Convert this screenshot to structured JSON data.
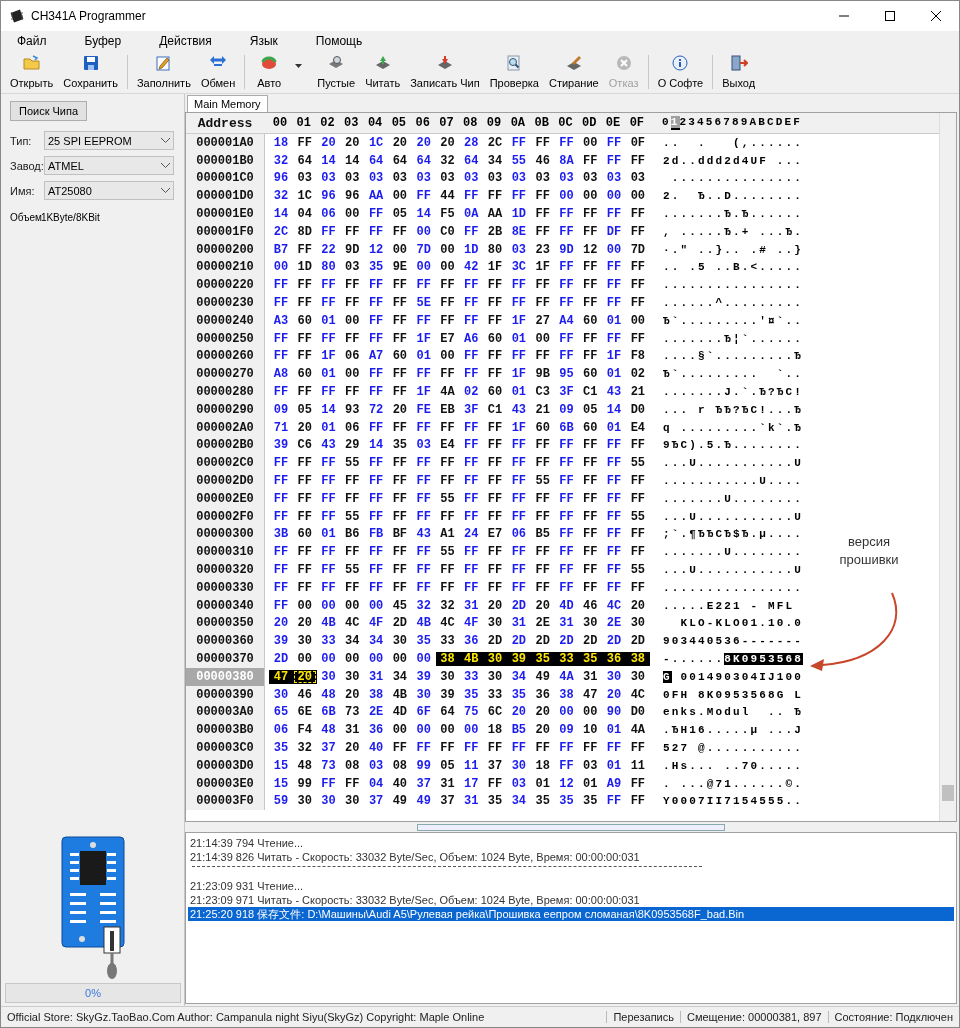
{
  "window": {
    "title": "CH341A Programmer"
  },
  "menu": [
    "Файл",
    "Буфер",
    "Действия",
    "Язык",
    "Помощь"
  ],
  "toolbar": [
    {
      "items": [
        {
          "label": "Открыть",
          "disabled": false,
          "dropdown": false
        },
        {
          "label": "Сохранить",
          "disabled": false,
          "dropdown": false
        }
      ]
    },
    {
      "items": [
        {
          "label": "Заполнить",
          "disabled": false,
          "dropdown": false
        },
        {
          "label": "Обмен",
          "disabled": false,
          "dropdown": false
        }
      ]
    },
    {
      "items": [
        {
          "label": "Авто",
          "disabled": false,
          "dropdown": true
        },
        {
          "label": "Пустые",
          "disabled": false,
          "dropdown": false
        },
        {
          "label": "Читать",
          "disabled": false,
          "dropdown": false
        },
        {
          "label": "Записать Чип",
          "disabled": false,
          "dropdown": false
        },
        {
          "label": "Проверка",
          "disabled": false,
          "dropdown": false
        },
        {
          "label": "Стирание",
          "disabled": false,
          "dropdown": false
        },
        {
          "label": "Отказ",
          "disabled": true,
          "dropdown": false
        }
      ]
    },
    {
      "items": [
        {
          "label": "О Софте",
          "disabled": false,
          "dropdown": false
        }
      ]
    },
    {
      "items": [
        {
          "label": "Выход",
          "disabled": false,
          "dropdown": false
        }
      ]
    }
  ],
  "left_panel": {
    "search_button": "Поиск Чипа",
    "fields": [
      {
        "label": "Тип:",
        "value": "25 SPI EEPROM"
      },
      {
        "label": "Завод:",
        "value": "ATMEL"
      },
      {
        "label": "Имя:",
        "value": "AT25080"
      }
    ],
    "size_label": "Объем",
    "size_value": "1KByte/8KBit",
    "progress": {
      "level": 0,
      "label": "0%"
    }
  },
  "hex_view": {
    "tab": "Main Memory",
    "address_header": "Address",
    "columns": [
      "00",
      "01",
      "02",
      "03",
      "04",
      "05",
      "06",
      "07",
      "08",
      "09",
      "0A",
      "0B",
      "0C",
      "0D",
      "0E",
      "0F"
    ],
    "ascii_header": [
      {
        "kind": "plain",
        "text": "0"
      },
      {
        "kind": "cursor",
        "text": "1"
      },
      {
        "kind": "plain",
        "text": "23456789ABCDEF"
      }
    ],
    "rows": [
      {
        "address": "000001A0",
        "selected": false,
        "bytes": "18 FF 20 20 1C 20 20 20 28 2C FF FF FF 00 FF 0F",
        "ascii": "..  .   (,......"
      },
      {
        "address": "000001B0",
        "selected": false,
        "bytes": "32 64 14 14 64 64 64 32 64 34 55 46 8A FF FF FF",
        "ascii": "2d..ddd2d4UF ..."
      },
      {
        "address": "000001C0",
        "selected": false,
        "bytes": "96 03 03 03 03 03 03 03 03 03 03 03 03 03 03 03",
        "ascii": " ..............."
      },
      {
        "address": "000001D0",
        "selected": false,
        "bytes": "32 1C 96 96 AA 00 FF 44 FF FF FF FF 00 00 00 00",
        "ascii": "2.  Ђ..D........"
      },
      {
        "address": "000001E0",
        "selected": false,
        "bytes": "14 04 06 00 FF 05 14 F5 0A AA 1D FF FF FF FF FF",
        "ascii": ".......Ђ.Ђ......"
      },
      {
        "address": "000001F0",
        "selected": false,
        "bytes": "2C 8D FF FF FF FF 00 C0 FF 2B 8E FF FF FF DF FF",
        "ascii": ", .....Ђ.+ ...Ђ."
      },
      {
        "address": "00000200",
        "selected": false,
        "bytes": "B7 FF 22 9D 12 00 7D 00 1D 80 03 23 9D 12 00 7D",
        "ascii": "·.\" ..}.. .# ..}"
      },
      {
        "address": "00000210",
        "selected": false,
        "bytes": "00 1D 80 03 35 9E 00 00 42 1F 3C 1F FF FF FF FF",
        "ascii": ".. .5 ..B.<....."
      },
      {
        "address": "00000220",
        "selected": false,
        "bytes": "FF FF FF FF FF FF FF FF FF FF FF FF FF FF FF FF",
        "ascii": "................"
      },
      {
        "address": "00000230",
        "selected": false,
        "bytes": "FF FF FF FF FF FF 5E FF FF FF FF FF FF FF FF FF",
        "ascii": "......^........."
      },
      {
        "address": "00000240",
        "selected": false,
        "bytes": "A3 60 01 00 FF FF FF FF FF FF 1F 27 A4 60 01 00",
        "ascii": "Ђ`.........'¤`.."
      },
      {
        "address": "00000250",
        "selected": false,
        "bytes": "FF FF FF FF FF FF 1F E7 A6 60 01 00 FF FF FF FF",
        "ascii": ".......Ђ¦`......"
      },
      {
        "address": "00000260",
        "selected": false,
        "bytes": "FF FF 1F 06 A7 60 01 00 FF FF FF FF FF FF 1F F8",
        "ascii": "....§`.........Ђ"
      },
      {
        "address": "00000270",
        "selected": false,
        "bytes": "A8 60 01 00 FF FF FF FF FF FF 1F 9B 95 60 01 02",
        "ascii": "Ђ`.........  `.."
      },
      {
        "address": "00000280",
        "selected": false,
        "bytes": "FF FF FF FF FF FF 1F 4A 02 60 01 C3 3F C1 43 21",
        "ascii": ".......J.`.Ђ?ЂC!"
      },
      {
        "address": "00000290",
        "selected": false,
        "bytes": "09 05 14 93 72 20 FE EB 3F C1 43 21 09 05 14 D0",
        "ascii": "... r ЂЂ?ЂC!...Ђ"
      },
      {
        "address": "000002A0",
        "selected": false,
        "bytes": "71 20 01 06 FF FF FF FF FF FF 1F 60 6B 60 01 E4",
        "ascii": "q .........`k`.Ђ"
      },
      {
        "address": "000002B0",
        "selected": false,
        "bytes": "39 C6 43 29 14 35 03 E4 FF FF FF FF FF FF FF FF",
        "ascii": "9ЂC).5.Ђ........"
      },
      {
        "address": "000002C0",
        "selected": false,
        "bytes": "FF FF FF 55 FF FF FF FF FF FF FF FF FF FF FF 55",
        "ascii": "...U...........U"
      },
      {
        "address": "000002D0",
        "selected": false,
        "bytes": "FF FF FF FF FF FF FF FF FF FF FF 55 FF FF FF FF",
        "ascii": "...........U...."
      },
      {
        "address": "000002E0",
        "selected": false,
        "bytes": "FF FF FF FF FF FF FF 55 FF FF FF FF FF FF FF FF",
        "ascii": ".......U........"
      },
      {
        "address": "000002F0",
        "selected": false,
        "bytes": "FF FF FF 55 FF FF FF FF FF FF FF FF FF FF FF 55",
        "ascii": "...U...........U"
      },
      {
        "address": "00000300",
        "selected": false,
        "bytes": "3B 60 01 B6 FB BF 43 A1 24 E7 06 B5 FF FF FF FF",
        "ascii": ";`.¶ЂЂCЂ$Ђ.µ...."
      },
      {
        "address": "00000310",
        "selected": false,
        "bytes": "FF FF FF FF FF FF FF 55 FF FF FF FF FF FF FF FF",
        "ascii": ".......U........"
      },
      {
        "address": "00000320",
        "selected": false,
        "bytes": "FF FF FF 55 FF FF FF FF FF FF FF FF FF FF FF 55",
        "ascii": "...U...........U"
      },
      {
        "address": "00000330",
        "selected": false,
        "bytes": "FF FF FF FF FF FF FF FF FF FF FF FF FF FF FF FF",
        "ascii": "................"
      },
      {
        "address": "00000340",
        "selected": false,
        "bytes": "FF 00 00 00 00 45 32 32 31 20 2D 20 4D 46 4C 20",
        "ascii": ".....E221 - MFL "
      },
      {
        "address": "00000350",
        "selected": false,
        "bytes": "20 20 4B 4C 4F 2D 4B 4C 4F 30 31 2E 31 30 2E 30",
        "ascii": "  KLO-KLO01.10.0"
      },
      {
        "address": "00000360",
        "selected": false,
        "bytes": "39 30 33 34 34 30 35 33 36 2D 2D 2D 2D 2D 2D 2D",
        "ascii": "903440536-------"
      },
      {
        "address": "00000370",
        "selected": false,
        "hex_parts": [
          {
            "kind": "plain",
            "bytes": "2D 00 00 00 00 00 00"
          },
          {
            "kind": "marked",
            "bytes": "38 4B 30 39 35 33 35 36 38"
          }
        ],
        "ascii_parts": [
          {
            "kind": "plain",
            "text": "-......"
          },
          {
            "kind": "marked",
            "text": "8K0953568"
          }
        ]
      },
      {
        "address": "00000380",
        "selected": true,
        "hex_parts": [
          {
            "kind": "marked",
            "bytes": "47"
          },
          {
            "kind": "cursor",
            "bytes": "20"
          },
          {
            "kind": "plain",
            "bytes": "30 30 31 34 39 30 33 30 34 49 4A 31 30 30"
          }
        ],
        "ascii_parts": [
          {
            "kind": "marked",
            "text": "G"
          },
          {
            "kind": "plain",
            "text": " 001490304IJ100"
          }
        ]
      },
      {
        "address": "00000390",
        "selected": false,
        "bytes": "30 46 48 20 38 4B 30 39 35 33 35 36 38 47 20 4C",
        "ascii": "0FH 8K0953568G L"
      },
      {
        "address": "000003A0",
        "selected": false,
        "bytes": "65 6E 6B 73 2E 4D 6F 64 75 6C 20 20 00 00 90 D0",
        "ascii": "enks.Modul  .. Ђ"
      },
      {
        "address": "000003B0",
        "selected": false,
        "bytes": "06 F4 48 31 36 00 00 00 00 18 B5 20 09 10 01 4A",
        "ascii": ".ЂH16.....µ ...J"
      },
      {
        "address": "000003C0",
        "selected": false,
        "bytes": "35 32 37 20 40 FF FF FF FF FF FF FF FF FF FF FF",
        "ascii": "527 @..........."
      },
      {
        "address": "000003D0",
        "selected": false,
        "bytes": "15 48 73 08 03 08 99 05 11 37 30 18 FF 03 01 11",
        "ascii": ".Hs... ..70....."
      },
      {
        "address": "000003E0",
        "selected": false,
        "bytes": "15 99 FF FF 04 40 37 31 17 FF 03 01 12 01 A9 FF",
        "ascii": ". ...@71......©."
      },
      {
        "address": "000003F0",
        "selected": false,
        "bytes": "59 30 30 30 37 49 49 37 31 35 34 35 35 35 FF FF",
        "ascii": "Y0007II7154555.."
      }
    ]
  },
  "annotation": {
    "text": "версия прошивки"
  },
  "log": [
    {
      "kind": "text",
      "text": "21:14:39 794 Чтение...",
      "selected": false
    },
    {
      "kind": "text",
      "text": "21:14:39 826 Читать - Скорость: 33032 Byte/Sec, Объем: 1024 Byte, Время: 00:00:00:031",
      "selected": false
    },
    {
      "kind": "separator"
    },
    {
      "kind": "text",
      "text": "21:23:09 931 Чтение...",
      "selected": false
    },
    {
      "kind": "text",
      "text": "21:23:09 971 Читать - Скорость: 33032 Byte/Sec, Объем: 1024 Byte, Время: 00:00:00:031",
      "selected": false
    },
    {
      "kind": "text",
      "text": "21:25:20 918 保存文件: D:\\Машины\\Audi A5\\Рулевая рейка\\Прошивка еепром сломаная\\8K0953568F_bad.Bin",
      "selected": true
    }
  ],
  "status_bar": [
    "Official Store: SkyGz.TaoBao.Com Author: Campanula night Siyu(SkyGz) Copyright: Maple Online",
    "Перезапись",
    "Смещение: 00000381, 897",
    "Состояние: Подключен"
  ]
}
